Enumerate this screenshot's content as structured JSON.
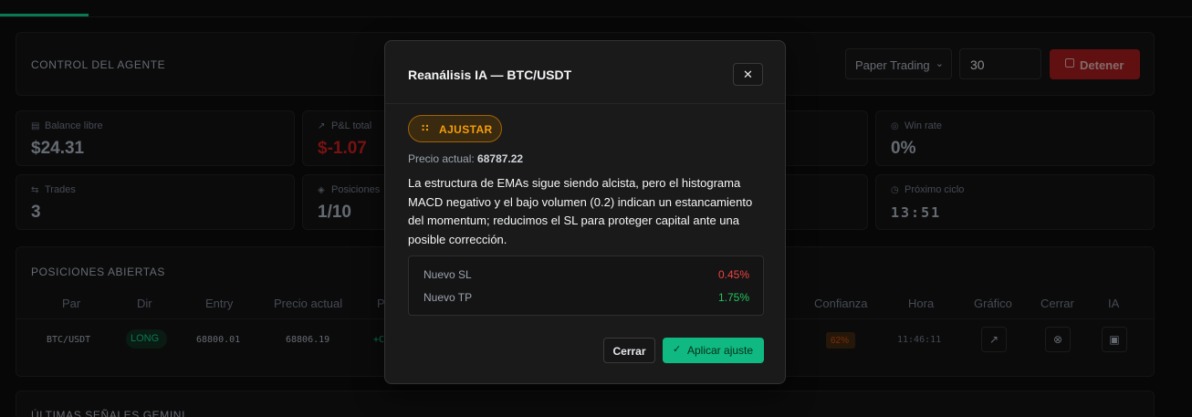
{
  "control": {
    "title": "CONTROL DEL AGENTE",
    "mode_selected": "Paper Trading",
    "cycle_value": "30",
    "stop_label": "Detener"
  },
  "stats": [
    {
      "label": "Balance libre",
      "value": "$24.31"
    },
    {
      "label": "P&L total",
      "value": "$-1.07"
    },
    {
      "label": "Win rate",
      "value": "0%"
    },
    {
      "label": "Trades",
      "value": "3"
    },
    {
      "label": "Posiciones",
      "value": "1/10"
    },
    {
      "label": "Próximo ciclo",
      "value": "13:51"
    }
  ],
  "positions": {
    "title": "POSICIONES ABIERTAS",
    "headers": [
      "Par",
      "Dir",
      "Entry",
      "Precio actual",
      "P",
      "Confianza",
      "Hora",
      "Gráfico",
      "Cerrar",
      "IA"
    ],
    "row": {
      "pair": "BTC/USDT",
      "dir": "LONG",
      "entry": "68800.01",
      "current": "68806.19",
      "pnl_partial": "+C",
      "confidence": "62%",
      "time": "11:46:11"
    }
  },
  "signals": {
    "title": "ÚLTIMAS SEÑALES GEMINI"
  },
  "modal": {
    "title": "Reanálisis IA — BTC/USDT",
    "close_glyph": "✕",
    "badge": "AJUSTAR",
    "price_label": "Precio actual:",
    "price_value": "68787.22",
    "description": "La estructura de EMAs sigue siendo alcista, pero el histograma MACD negativo y el bajo volumen (0.2) indican un estancamiento del momentum; reducimos el SL para proteger capital ante una posible corrección.",
    "sl_label": "Nuevo SL",
    "sl_value": "0.45%",
    "tp_label": "Nuevo TP",
    "tp_value": "1.75%",
    "cancel_label": "Cerrar",
    "apply_label": "Aplicar ajuste"
  },
  "colors": {
    "accent": "#10b981",
    "danger": "#b91c1c",
    "warning": "#f59e0b",
    "sl": "#ef4444",
    "tp": "#22c55e"
  }
}
